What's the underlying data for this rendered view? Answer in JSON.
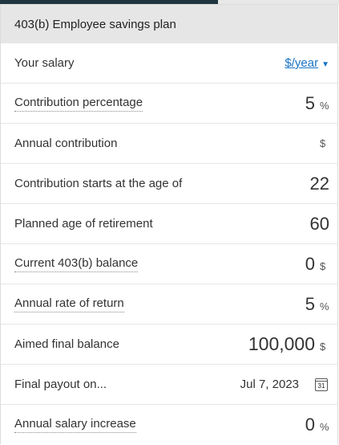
{
  "header": {
    "title": "403(b) Employee savings plan"
  },
  "rows": {
    "salary": {
      "label": "Your salary",
      "unit_link_prefix": "$",
      "unit_link_text": "/year"
    },
    "contribution_pct": {
      "label": "Contribution percentage",
      "value": "5",
      "unit": "%"
    },
    "annual_contribution": {
      "label": "Annual contribution",
      "value": "",
      "unit": "$"
    },
    "start_age": {
      "label": "Contribution starts at the age of",
      "value": "22"
    },
    "retire_age": {
      "label": "Planned age of retirement",
      "value": "60"
    },
    "current_balance": {
      "label": "Current 403(b) balance",
      "value": "0",
      "unit": "$"
    },
    "rate_of_return": {
      "label": "Annual rate of return",
      "value": "5",
      "unit": "%"
    },
    "aimed_balance": {
      "label": "Aimed final balance",
      "value": "100,000",
      "unit": "$"
    },
    "final_payout": {
      "label": "Final payout on...",
      "date": "Jul 7, 2023",
      "calendar_day": "31"
    },
    "salary_increase": {
      "label": "Annual salary increase",
      "value": "0",
      "unit": "%"
    }
  },
  "colors": {
    "accent_bar": "#1f3640",
    "link": "#1a73c6",
    "header_bg": "#e6e6e6"
  },
  "icons": {
    "calendar": "calendar-icon",
    "dropdown": "chevron-down-icon"
  }
}
